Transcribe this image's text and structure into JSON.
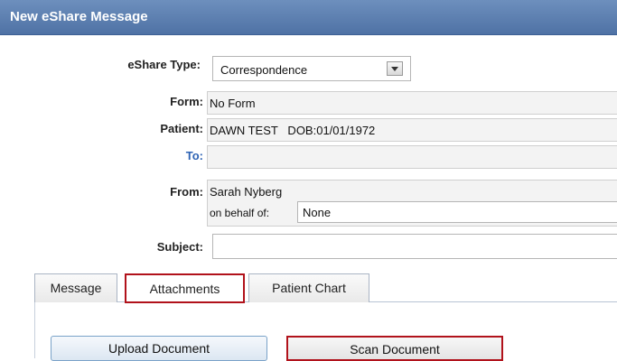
{
  "window": {
    "title": "New eShare Message"
  },
  "form": {
    "eshare_type_label": "eShare Type:",
    "eshare_type_value": "Correspondence",
    "form_label": "Form:",
    "form_value": "No Form",
    "patient_label": "Patient:",
    "patient_value": "DAWN TEST   DOB:01/01/1972",
    "to_label": "To:",
    "to_value": "",
    "from_label": "From:",
    "from_value": "Sarah Nyberg",
    "behalf_label": "on behalf of:",
    "behalf_value": "None",
    "subject_label": "Subject:",
    "subject_value": ""
  },
  "tabs": [
    {
      "label": "Message"
    },
    {
      "label": "Attachments"
    },
    {
      "label": "Patient Chart"
    }
  ],
  "actions": {
    "upload_label": "Upload Document",
    "scan_label": "Scan Document"
  },
  "colors": {
    "header": "#5878aa",
    "highlight": "#b1121b",
    "link": "#2e63b4"
  }
}
